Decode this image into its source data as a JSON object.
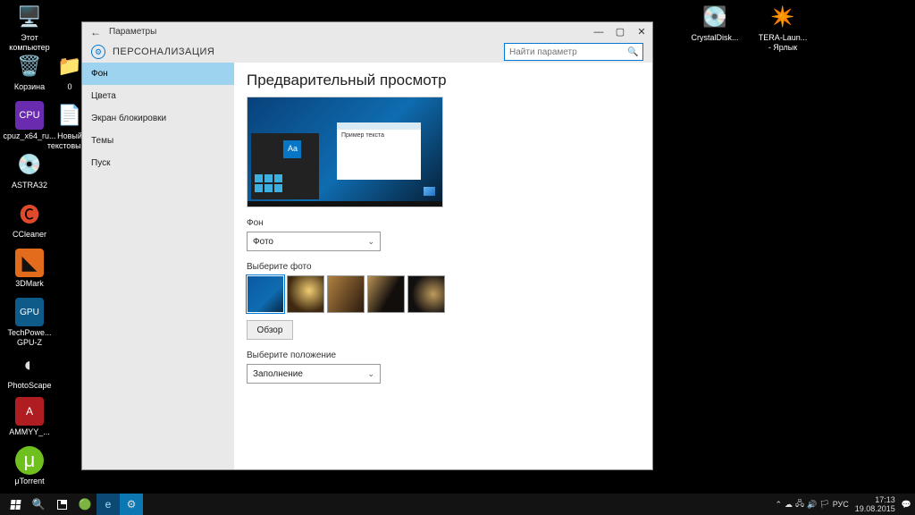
{
  "desktop_icons": {
    "col1": [
      {
        "label": "Этот компьютер",
        "glyph": "🖥️"
      },
      {
        "label": "Корзина",
        "glyph": "🗑️"
      },
      {
        "label": "cpuz_x64_ru...",
        "glyph": "📦",
        "bg": "#6b2baf"
      },
      {
        "label": "ASTRA32",
        "glyph": "🔍"
      },
      {
        "label": "CCleaner",
        "glyph": "🧹"
      },
      {
        "label": "3DMark",
        "glyph": "▶",
        "bg": "#e36c1c"
      },
      {
        "label": "TechPowe... GPU-Z",
        "glyph": "🪟"
      },
      {
        "label": "PhotoScape",
        "glyph": "◔"
      },
      {
        "label": "AMMYY_...",
        "glyph": "🛜",
        "bg": "#b01d20"
      },
      {
        "label": "μTorrent",
        "glyph": "μ",
        "bg": "#6fbf1f"
      }
    ],
    "col2": [
      {
        "label": "0",
        "glyph": "📁"
      },
      {
        "label": "Новый текстовый...",
        "glyph": "📄"
      }
    ],
    "right": [
      {
        "label": "CrystalDisk...",
        "glyph": "💽"
      },
      {
        "label": "TERA-Laun... - Ярлык",
        "glyph": "✴"
      }
    ]
  },
  "window": {
    "back": "←",
    "title": "Параметры",
    "section": "ПЕРСОНАЛИЗАЦИЯ",
    "search_placeholder": "Найти параметр",
    "min": "—",
    "max": "▢",
    "close": "✕",
    "sidebar": [
      "Фон",
      "Цвета",
      "Экран блокировки",
      "Темы",
      "Пуск"
    ],
    "content": {
      "heading": "Предварительный просмотр",
      "sample_text": "Пример текста",
      "sample_aa": "Aa",
      "bg_label": "Фон",
      "bg_value": "Фото",
      "chev": "⌄",
      "pick_photo": "Выберите фото",
      "browse": "Обзор",
      "fit_label": "Выберите положение",
      "fit_value": "Заполнение"
    }
  },
  "taskbar": {
    "lang": "РУС",
    "time": "17:13",
    "date": "19.08.2015",
    "tray_up": "⌃"
  }
}
